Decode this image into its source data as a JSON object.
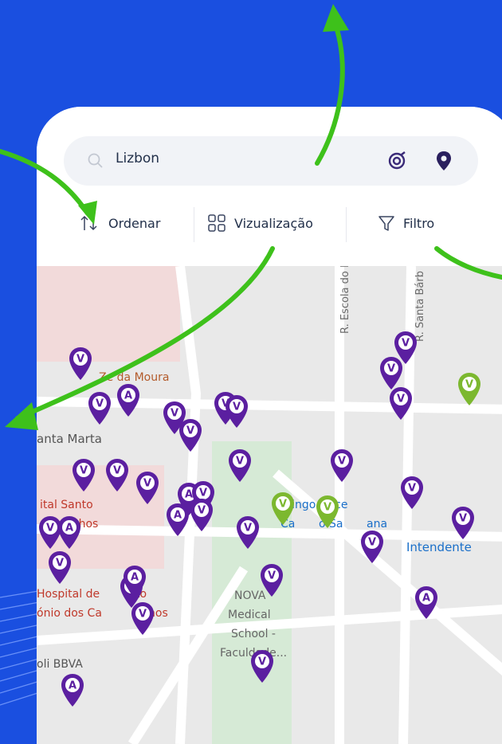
{
  "search": {
    "value": "Lizbon"
  },
  "toolbar": {
    "sort_label": "Ordenar",
    "view_label": "Vizualização",
    "filter_label": "Filtro"
  },
  "map": {
    "streets": [
      "R. Escola do Exé",
      "R. Santa Bárb",
      "anta Marta"
    ],
    "places": [
      "Ze da Moura",
      "ital Santo",
      "uchos",
      "Hospital de",
      "to",
      "ónio dos Ca",
      "hos",
      "oli BBVA",
      "Pingo Doce",
      "Ca",
      "o Sa",
      "ana",
      "Intendente",
      "NOVA",
      "Medical",
      "School -",
      "Faculdade..."
    ],
    "markers": [
      {
        "label": "V",
        "color": "#5b1fa0"
      },
      {
        "label": "A",
        "color": "#5b1fa0"
      },
      {
        "label": "V",
        "color": "#5b1fa0"
      },
      {
        "label": "A",
        "color": "#5b1fa0"
      },
      {
        "label": "V",
        "color": "#5b1fa0"
      },
      {
        "label": "V",
        "color": "#5b1fa0"
      },
      {
        "label": "A",
        "color": "#5b1fa0"
      },
      {
        "label": "V",
        "color": "#5b1fa0"
      },
      {
        "label": "V",
        "color": "#5b1fa0"
      },
      {
        "label": "V",
        "color": "#5b1fa0"
      },
      {
        "label": "V",
        "color": "#5b1fa0"
      },
      {
        "label": "V",
        "color": "#5b1fa0"
      },
      {
        "label": "V",
        "color": "#5b1fa0"
      },
      {
        "label": "V",
        "color": "#7cb82f"
      },
      {
        "label": "V",
        "color": "#5b1fa0"
      },
      {
        "label": "V",
        "color": "#5b1fa0"
      },
      {
        "label": "V",
        "color": "#5b1fa0"
      },
      {
        "label": "V",
        "color": "#5b1fa0"
      },
      {
        "label": "V",
        "color": "#5b1fa0"
      },
      {
        "label": "V",
        "color": "#5b1fa0"
      },
      {
        "label": "V",
        "color": "#5b1fa0"
      },
      {
        "label": "V",
        "color": "#7cb82f"
      },
      {
        "label": "V",
        "color": "#7cb82f"
      },
      {
        "label": "V",
        "color": "#5b1fa0"
      },
      {
        "label": "V",
        "color": "#5b1fa0"
      },
      {
        "label": "A",
        "color": "#5b1fa0"
      },
      {
        "label": "V",
        "color": "#5b1fa0"
      },
      {
        "label": "V",
        "color": "#5b1fa0"
      },
      {
        "label": "V",
        "color": "#5b1fa0"
      },
      {
        "label": "A",
        "color": "#5b1fa0"
      },
      {
        "label": "V",
        "color": "#5b1fa0"
      },
      {
        "label": "A",
        "color": "#5b1fa0"
      },
      {
        "label": "V",
        "color": "#5b1fa0"
      },
      {
        "label": "A",
        "color": "#5b1fa0"
      },
      {
        "label": "V",
        "color": "#5b1fa0"
      },
      {
        "label": "V",
        "color": "#5b1fa0"
      }
    ]
  },
  "colors": {
    "background": "#1a4fe0",
    "brand_purple": "#5b1fa0",
    "accent_green": "#7cb82f",
    "arrow_green": "#3ec11b"
  }
}
